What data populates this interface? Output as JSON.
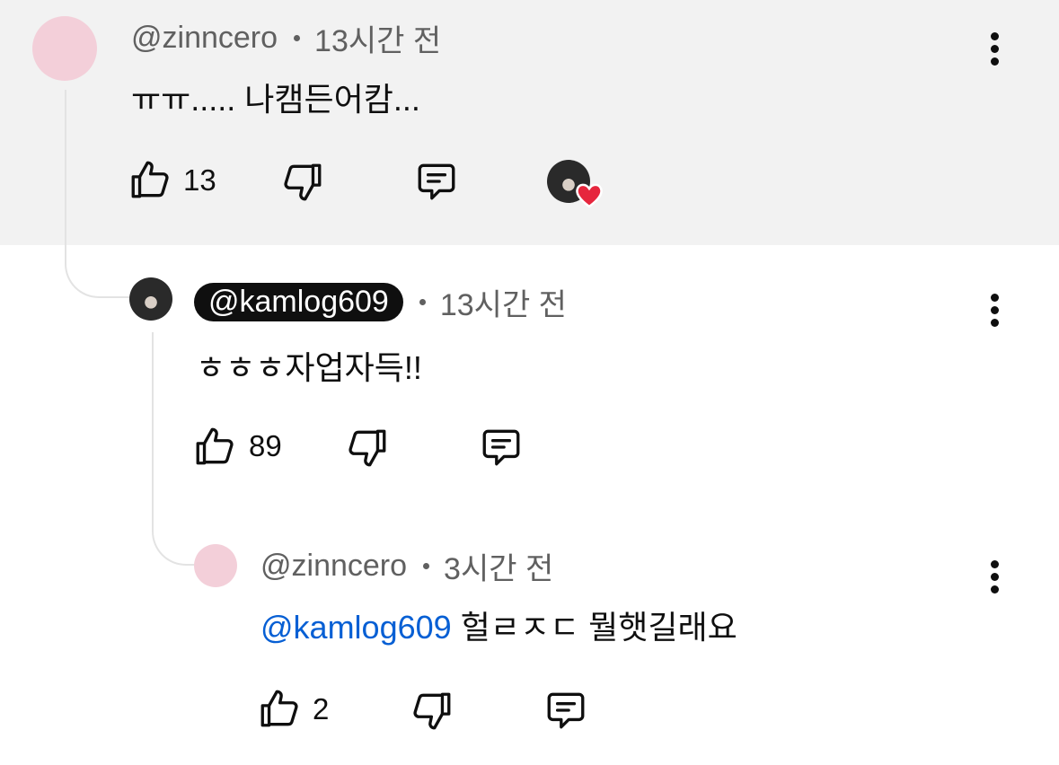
{
  "comments": [
    {
      "author": "@zinncero",
      "time": "13시간 전",
      "text": "ㅠㅠ..... 나캠든어캄...",
      "likes": "13",
      "creator_heart": true
    },
    {
      "author": "@kamlog609",
      "time": "13시간 전",
      "text": "ㅎㅎㅎ자업자득!!",
      "likes": "89",
      "is_creator": true
    },
    {
      "author": "@zinncero",
      "time": "3시간 전",
      "mention": "@kamlog609",
      "text": "헐ㄹㅈㄷ 뭘햇길래요",
      "likes": "2"
    }
  ],
  "colors": {
    "highlight_bg": "#f2f2f2",
    "mention": "#065fd4",
    "heart": "#e6263d",
    "avatar_pink": "#f3cfd9"
  },
  "icons": [
    "like-icon",
    "dislike-icon",
    "reply-icon",
    "more-options-icon",
    "heart-icon"
  ]
}
